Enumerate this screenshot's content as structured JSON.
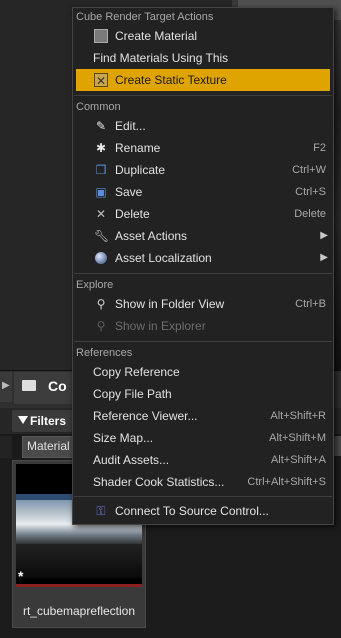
{
  "background": {
    "folder_tab_label": "Co",
    "filters_label": "Filters",
    "filter_chip_label": "Material",
    "right_chip_label": "",
    "asset": {
      "name": "rt_cubemapreflection",
      "badge": "*"
    }
  },
  "menu": {
    "sections": {
      "cube": "Cube Render Target Actions",
      "common": "Common",
      "explore": "Explore",
      "references": "References"
    },
    "items": {
      "create_material": "Create Material",
      "find_materials": "Find Materials Using This",
      "create_static_texture": "Create Static Texture",
      "edit": "Edit...",
      "rename": "Rename",
      "rename_sc": "F2",
      "duplicate": "Duplicate",
      "duplicate_sc": "Ctrl+W",
      "save": "Save",
      "save_sc": "Ctrl+S",
      "delete": "Delete",
      "delete_sc": "Delete",
      "asset_actions": "Asset Actions",
      "asset_localization": "Asset Localization",
      "show_folder": "Show in Folder View",
      "show_folder_sc": "Ctrl+B",
      "show_explorer": "Show in Explorer",
      "copy_reference": "Copy Reference",
      "copy_file_path": "Copy File Path",
      "reference_viewer": "Reference Viewer...",
      "reference_viewer_sc": "Alt+Shift+R",
      "size_map": "Size Map...",
      "size_map_sc": "Alt+Shift+M",
      "audit_assets": "Audit Assets...",
      "audit_assets_sc": "Alt+Shift+A",
      "shader_cook": "Shader Cook Statistics...",
      "shader_cook_sc": "Ctrl+Alt+Shift+S",
      "connect_source": "Connect To Source Control..."
    },
    "icons": {
      "create_material": "material-icon",
      "create_static_texture": "static-texture-icon",
      "edit": "pencil-icon",
      "rename": "rename-icon",
      "duplicate": "duplicate-icon",
      "save": "save-icon",
      "delete": "delete-x-icon",
      "asset_actions": "wrench-icon",
      "asset_localization": "globe-icon",
      "show_folder": "search-icon",
      "show_explorer": "search-icon",
      "connect_source": "source-control-icon"
    },
    "highlight_color": "#e0a400"
  }
}
